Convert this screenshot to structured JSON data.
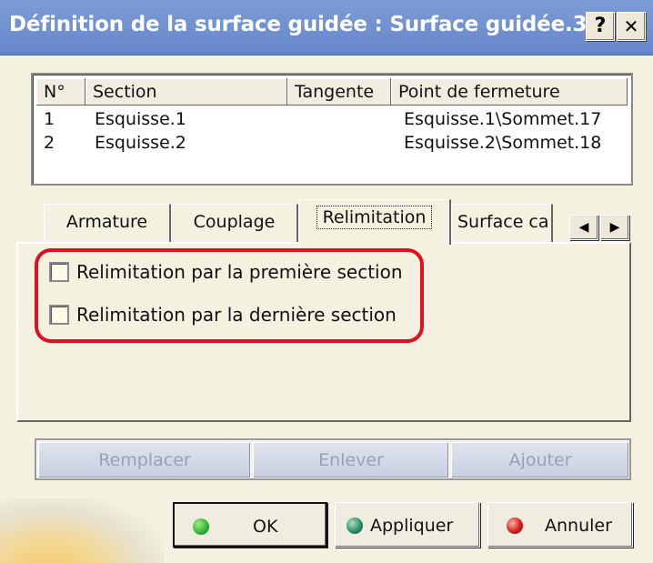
{
  "window": {
    "title": "Définition de la surface guidée : Surface guidée.3",
    "help_label": "?",
    "close_label": "✕"
  },
  "sections_table": {
    "columns": [
      "N°",
      "Section",
      "Tangente",
      "Point de fermeture"
    ],
    "rows": [
      {
        "num": "1",
        "section": "Esquisse.1",
        "tangent": "",
        "closing_point": "Esquisse.1\\Sommet.17"
      },
      {
        "num": "2",
        "section": "Esquisse.2",
        "tangent": "",
        "closing_point": "Esquisse.2\\Sommet.18"
      }
    ]
  },
  "tabs": {
    "items": [
      "Armature",
      "Couplage",
      "Relimitation",
      "Surface ca"
    ],
    "active": "Relimitation",
    "scroll_left": "◀",
    "scroll_right": "▶"
  },
  "relimitation": {
    "first_section_label": "Relimitation par la première section",
    "first_section_checked": false,
    "last_section_label": "Relimitation par la dernière section",
    "last_section_checked": false
  },
  "actions": {
    "replace": "Remplacer",
    "remove": "Enlever",
    "add": "Ajouter"
  },
  "buttons": {
    "ok": "OK",
    "apply": "Appliquer",
    "cancel": "Annuler"
  },
  "colors": {
    "highlight": "#e0101f",
    "ok_dot": "#2db13a",
    "apply_dot": "#2f8f6a",
    "cancel_dot": "#d42020"
  }
}
